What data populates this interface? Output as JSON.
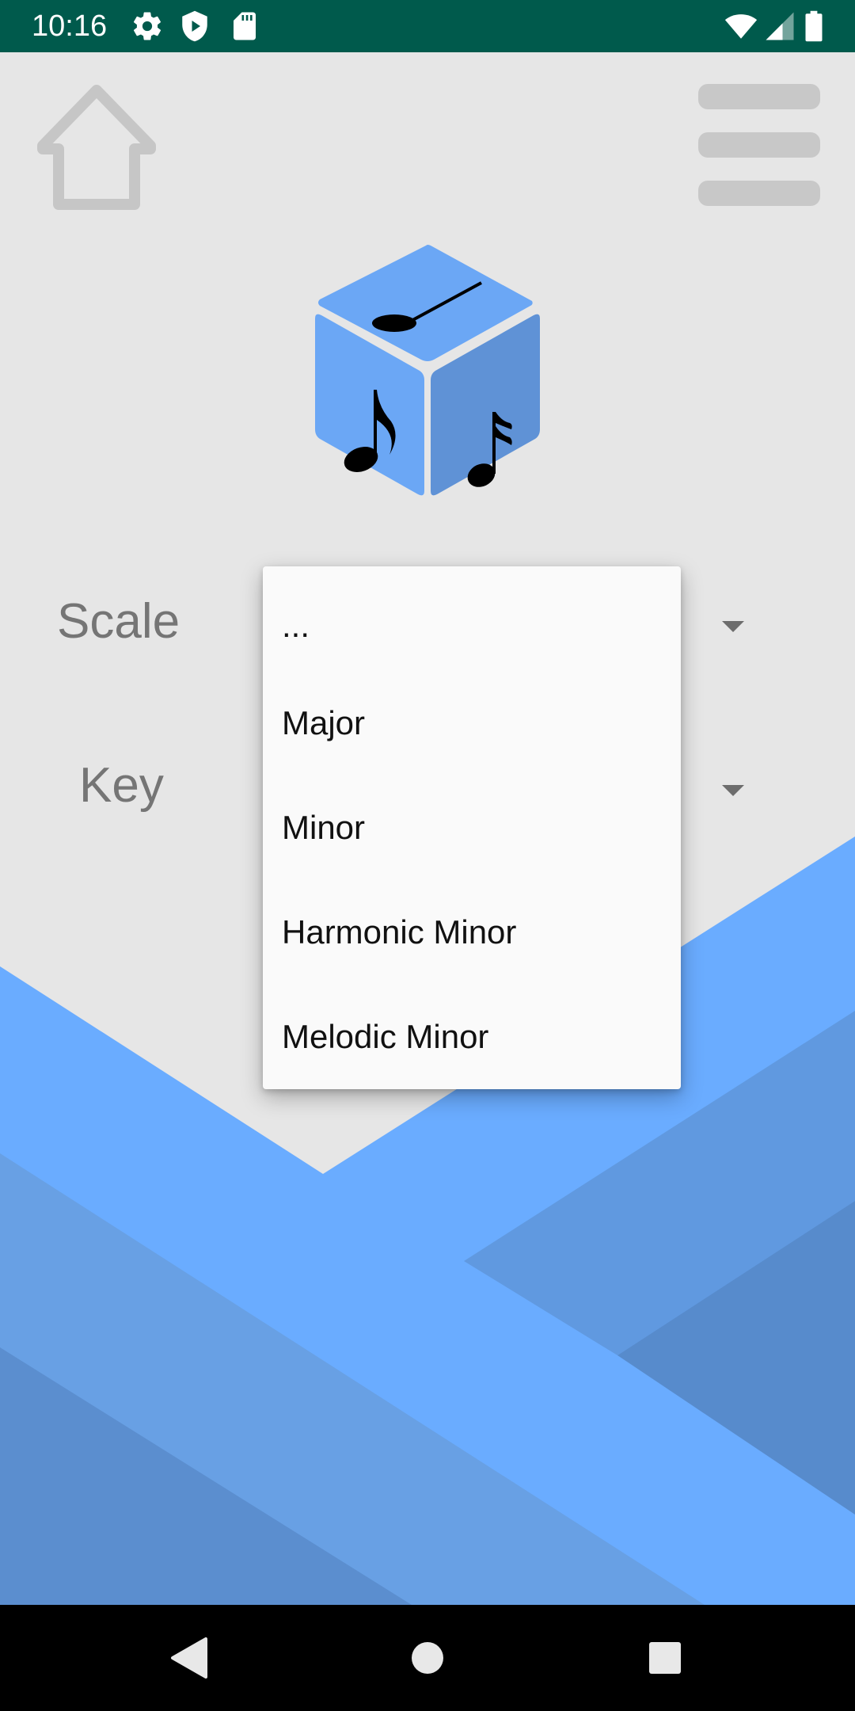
{
  "status_bar": {
    "time": "10:16",
    "left_icons": [
      "settings-icon",
      "shield-play-icon",
      "sd-card-icon"
    ],
    "right_icons": [
      "wifi-icon",
      "signal-icon",
      "battery-icon"
    ],
    "background": "#005a4c"
  },
  "toolbar": {
    "home_icon": "home-icon",
    "menu_icon": "hamburger-menu-icon"
  },
  "logo": {
    "icon": "music-dice-icon",
    "color": "#6ba7f5"
  },
  "form": {
    "scale_label": "Scale",
    "key_label": "Key"
  },
  "dropdown": {
    "options": [
      "...",
      "Major",
      "Minor",
      "Harmonic Minor",
      "Melodic Minor"
    ]
  },
  "colors": {
    "background": "#e6e6e6",
    "accent_blue": "#6aacff",
    "label_gray": "#757575"
  },
  "nav_bar": {
    "back_icon": "back-triangle-icon",
    "home_icon": "home-circle-icon",
    "recents_icon": "recents-square-icon"
  }
}
